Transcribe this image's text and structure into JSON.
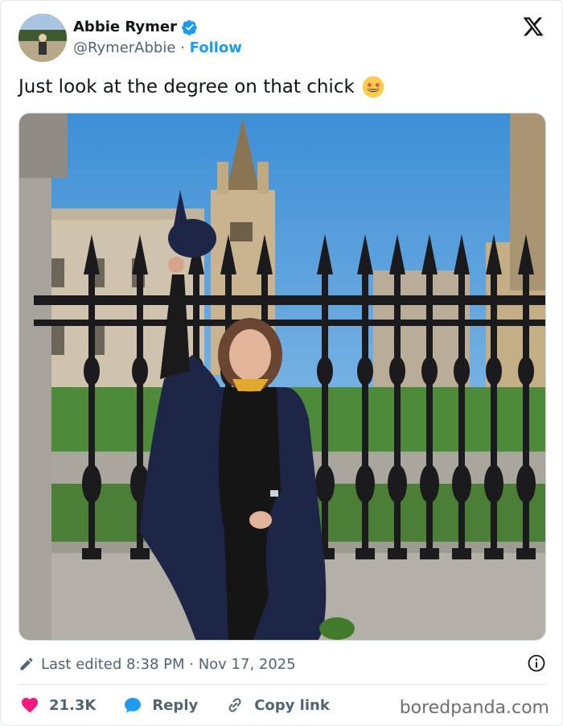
{
  "author": {
    "name": "Abbie Rymer",
    "handle": "@RymerAbbie",
    "separator": "·",
    "follow_label": "Follow"
  },
  "tweet": {
    "text": "Just look at the degree on that chick",
    "emoji": "star-struck-emoji"
  },
  "meta": {
    "edited": "Last edited 8:38 PM · Nov 17, 2025"
  },
  "actions": {
    "likes": "21.3K",
    "reply_label": "Reply",
    "copy_label": "Copy link"
  },
  "watermark": "boredpanda.com",
  "colors": {
    "accent": "#1d9bf0",
    "like": "#f91880",
    "text": "#0f1419",
    "muted": "#536471"
  },
  "icons": [
    "verified-badge-icon",
    "x-logo-icon",
    "pencil-icon",
    "info-icon",
    "heart-icon",
    "reply-bubble-icon",
    "link-icon"
  ]
}
